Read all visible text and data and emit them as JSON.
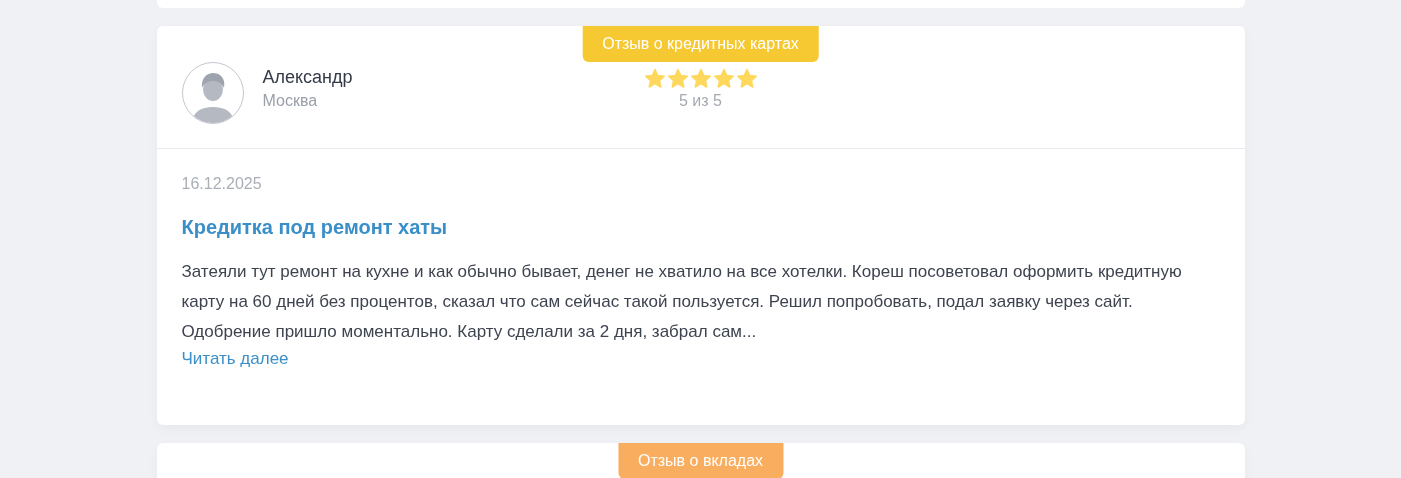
{
  "reviews": [
    {
      "badge": "Отзыв о кредитных картах",
      "color": "#f6c932",
      "author": "Александр",
      "city": "Москва",
      "stars": 5,
      "rating": "5 из 5",
      "date": "16.12.2025",
      "title": "Кредитка под ремонт хаты",
      "text": "Затеяли тут ремонт на кухне и как обычно бывает, денег не хватило на все хотелки. Кореш посоветовал оформить кредитную карту на 60 дней без процентов, сказал что сам сейчас такой пользуется. Решил попробовать, подал заявку через сайт. Одобрение пришло моментально. Карту сделали за 2 дня, забрал сам...",
      "more": "Читать далее"
    },
    {
      "badge": "Отзыв о вкладах",
      "color": "#f9ad5e"
    }
  ]
}
